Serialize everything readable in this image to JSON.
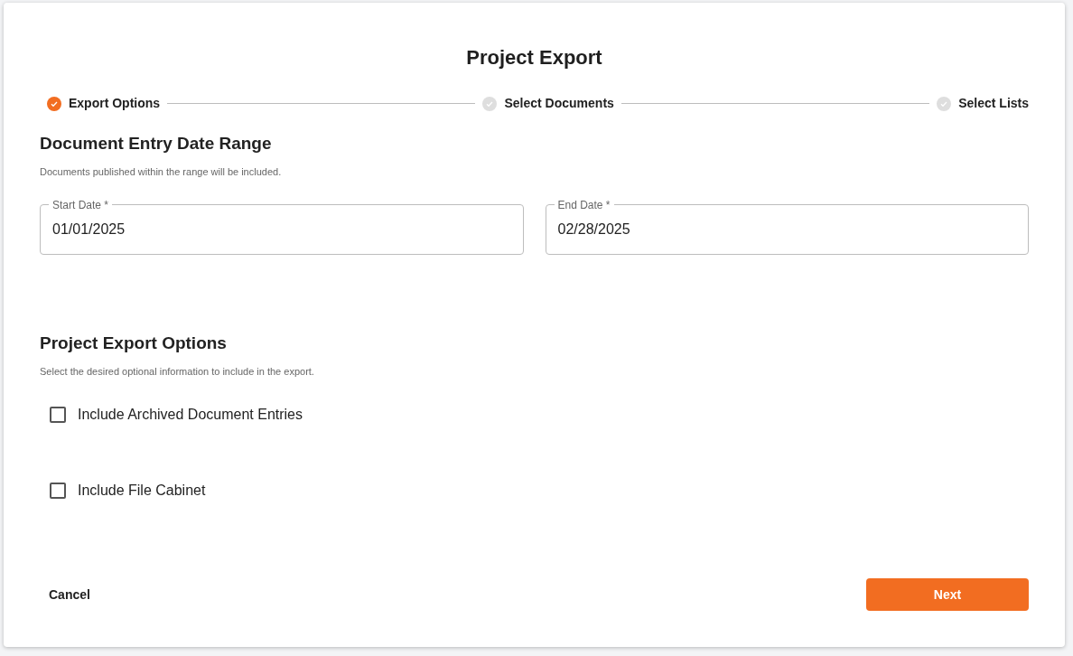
{
  "title": "Project Export",
  "steps": [
    {
      "label": "Export Options",
      "completed": true
    },
    {
      "label": "Select Documents",
      "completed": false
    },
    {
      "label": "Select Lists",
      "completed": false
    }
  ],
  "date_range": {
    "heading": "Document Entry Date Range",
    "description": "Documents published within the range will be included.",
    "fields": [
      {
        "label": "Start Date *",
        "value": "01/01/2025"
      },
      {
        "label": "End Date *",
        "value": "02/28/2025"
      }
    ]
  },
  "export_options": {
    "heading": "Project Export Options",
    "description": "Select the desired optional information to include in the export.",
    "options": [
      {
        "label": "Include Archived Document Entries",
        "checked": false
      },
      {
        "label": "Include File Cabinet",
        "checked": false
      }
    ]
  },
  "buttons": {
    "cancel": "Cancel",
    "next": "Next"
  }
}
